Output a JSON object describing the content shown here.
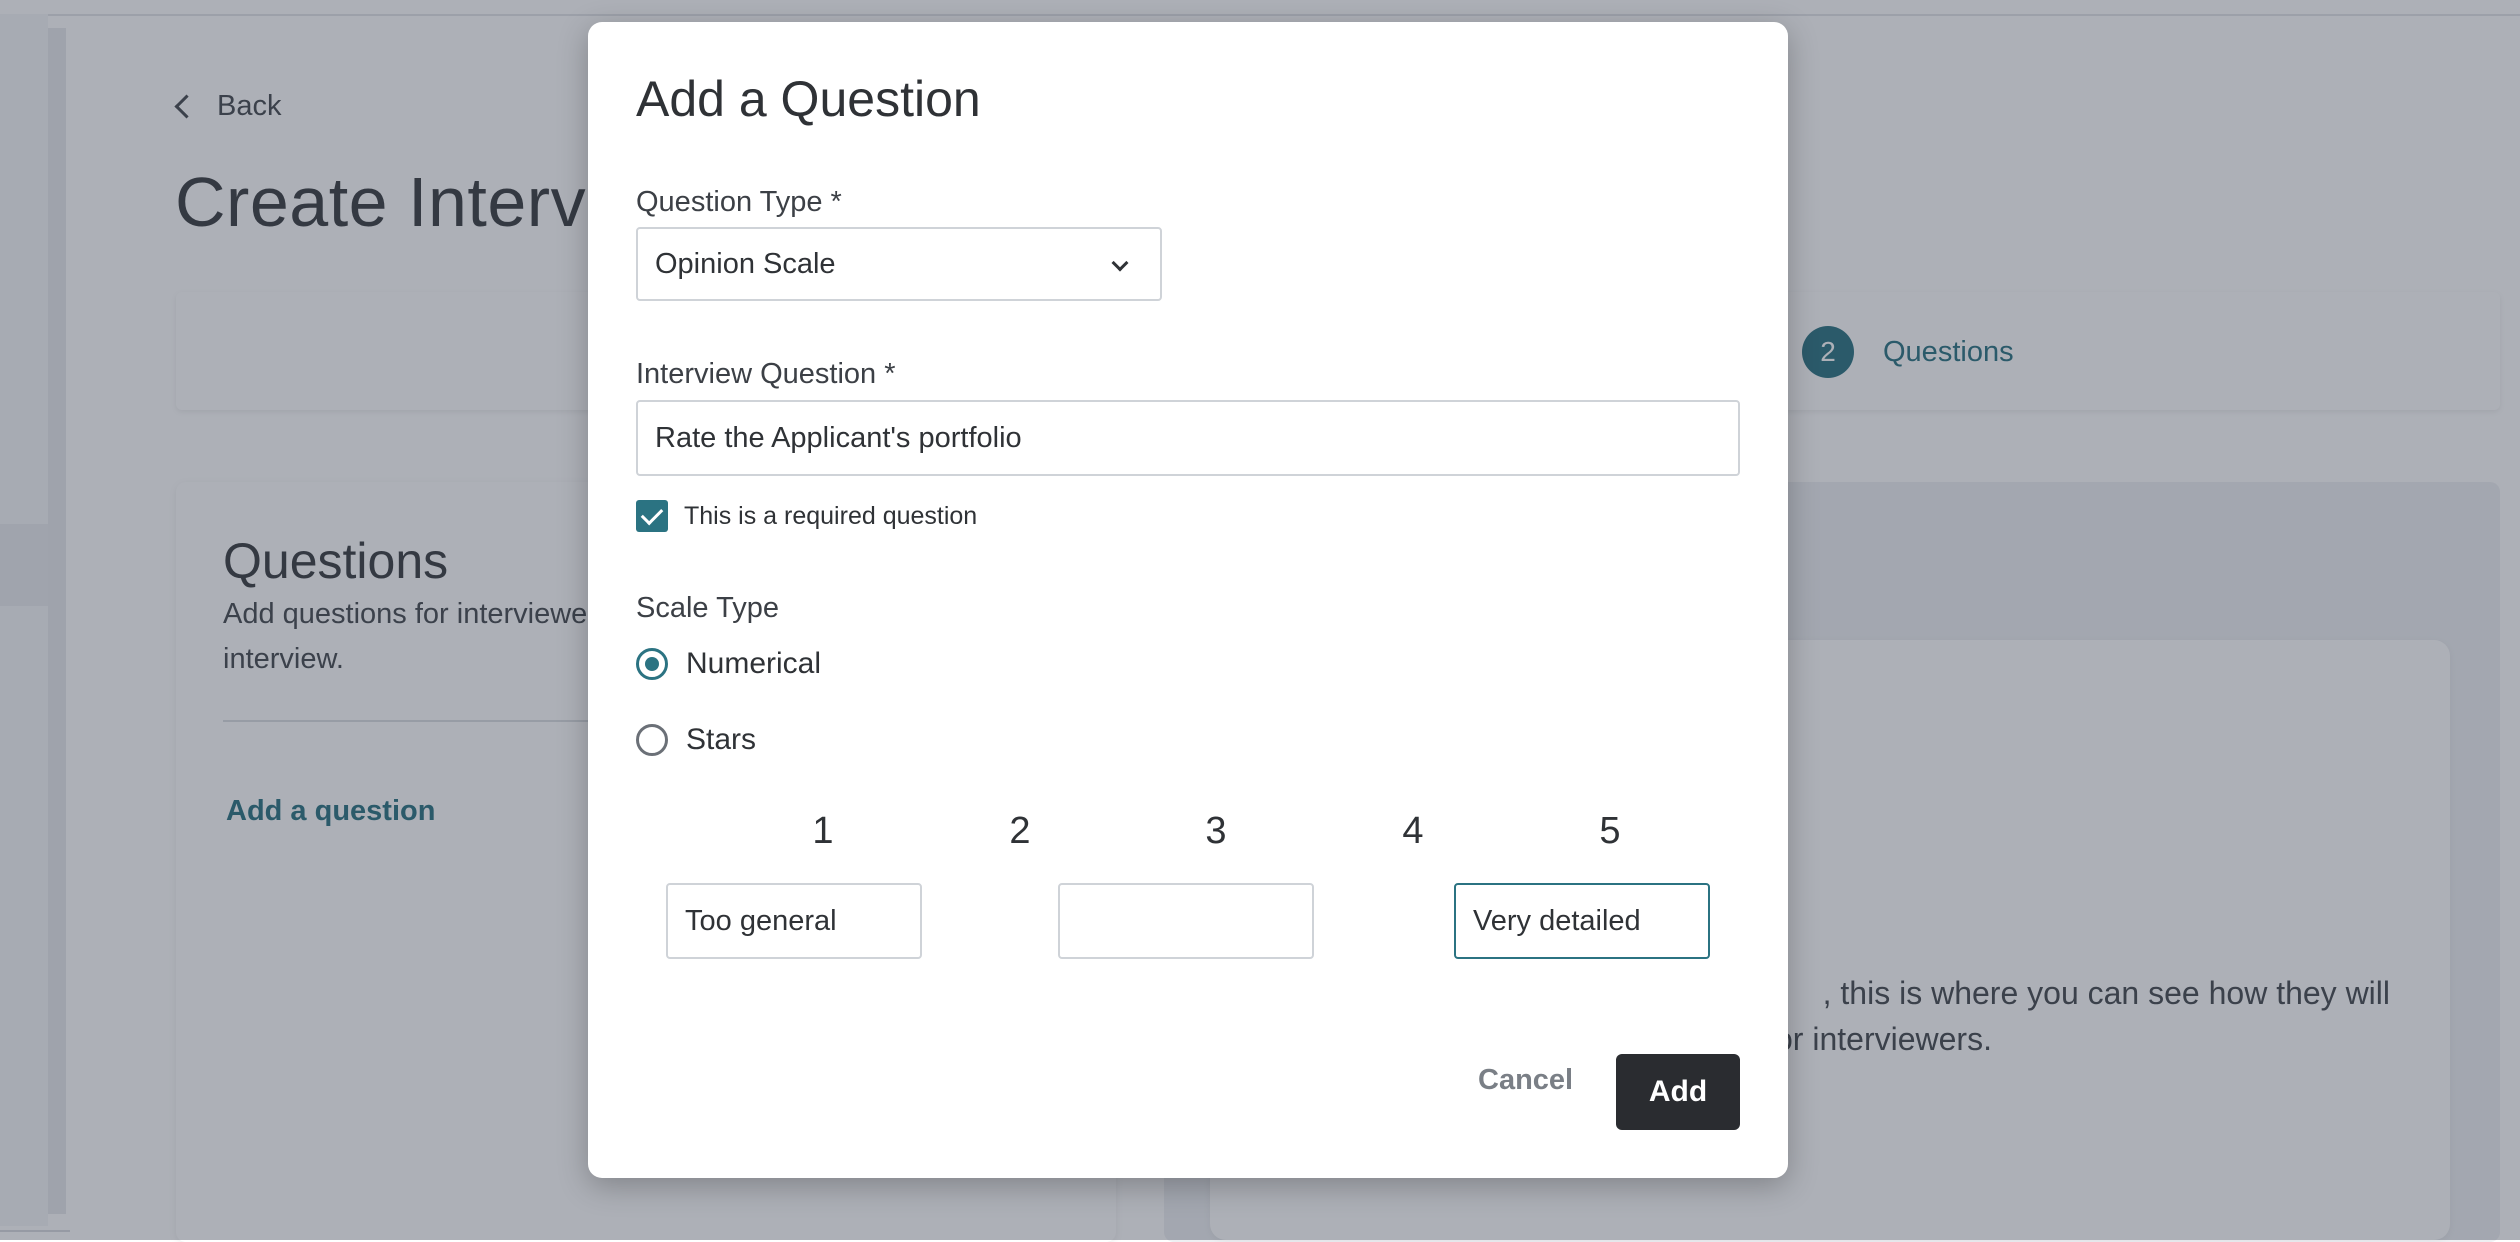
{
  "background": {
    "back_label": "Back",
    "page_title": "Create Interv",
    "stepper": {
      "step_number": "2",
      "step_label": "Questions"
    },
    "questions_card": {
      "title": "Questions",
      "description": "Add questions for interviewe applicants interview.",
      "add_link": "Add a question"
    },
    "preview": {
      "text_line1": ", this is where you can see how they will",
      "text_line2": "or interviewers."
    }
  },
  "modal": {
    "title": "Add a Question",
    "question_type": {
      "label": "Question Type *",
      "value": "Opinion Scale"
    },
    "interview_question": {
      "label": "Interview Question *",
      "value": "Rate the Applicant's portfolio"
    },
    "required_checkbox": {
      "label": "This is a required question",
      "checked": true
    },
    "scale_type": {
      "label": "Scale Type",
      "options": [
        {
          "label": "Numerical",
          "selected": true
        },
        {
          "label": "Stars",
          "selected": false
        }
      ]
    },
    "scale_numbers": [
      "1",
      "2",
      "3",
      "4",
      "5"
    ],
    "scale_labels": {
      "low": "Too general",
      "mid": "",
      "high": "Very detailed"
    },
    "buttons": {
      "cancel": "Cancel",
      "add": "Add"
    }
  },
  "colors": {
    "accent": "#2b7382",
    "primary_button": "#2a2c30",
    "overlay": "rgba(60,66,84,0.42)"
  },
  "icons": [
    "chevron-left-icon",
    "chevron-down-icon",
    "checkmark-icon"
  ]
}
